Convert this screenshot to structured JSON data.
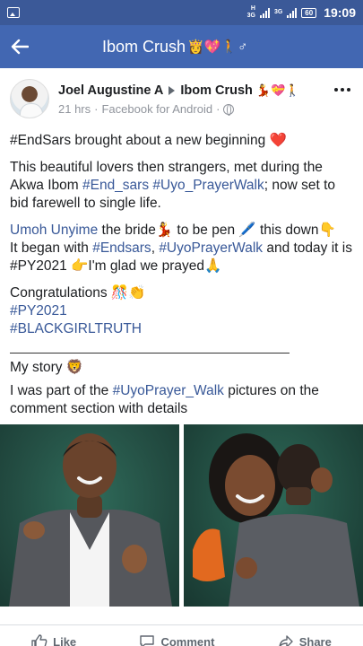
{
  "status_bar": {
    "network_top": "H",
    "network_labels": [
      "3G",
      "3G"
    ],
    "battery": "60",
    "time": "19:09"
  },
  "app_bar": {
    "title": "Ibom Crush",
    "title_emoji": "👸💖🚶♂"
  },
  "post": {
    "author": "Joel Augustine A",
    "group": "Ibom Crush",
    "group_emoji": "💃💝🚶",
    "time": "21 hrs",
    "source": "Facebook for Android",
    "line1": "#EndSars brought about a new beginning ❤️",
    "p2_pre": "This beautiful lovers then strangers, met during the Akwa Ibom ",
    "p2_tag1": "#End_sars",
    "p2_tag2": "#Uyo_PrayerWalk",
    "p2_post": "; now set to bid farewell to single life.",
    "p3_mention": "Umoh Unyime",
    "p3_a": " the bride💃 to be pen 🖊️ this down👇",
    "p3_b": "It began with ",
    "p3_tag1": "#Endsars",
    "p3_c": ", ",
    "p3_tag2": "#UyoPrayerWalk",
    "p3_d": " and today it is #PY2021 👉I'm glad we prayed🙏",
    "congrats": "Congratulations 🎊👏",
    "tag_py": "#PY2021",
    "tag_bgt": "#BLACKGIRLTRUTH",
    "my_story": "My story 🦁",
    "p5_pre": "I was part of the ",
    "p5_tag": "#UyoPrayer_Walk",
    "p5_post": " pictures on the comment section with details"
  },
  "actions": {
    "like": "Like",
    "comment": "Comment",
    "share": "Share"
  },
  "colors": {
    "statusbar": "#3b5998",
    "appbar": "#4267b2",
    "link": "#385898"
  }
}
